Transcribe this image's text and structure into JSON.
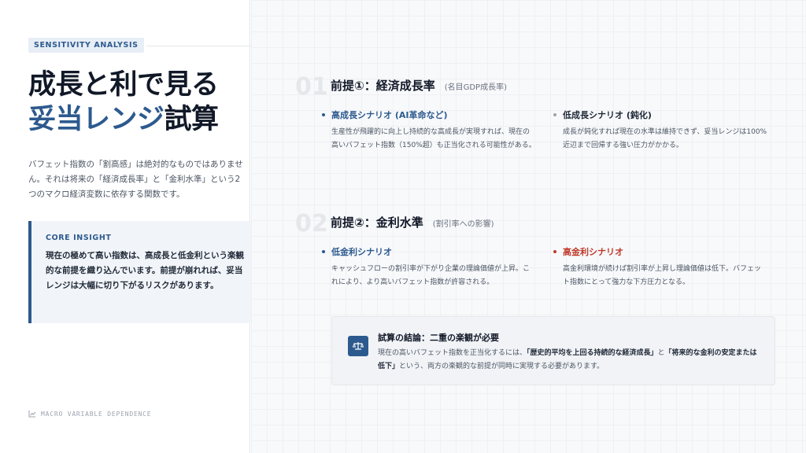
{
  "left": {
    "tag": "SENSITIVITY ANALYSIS",
    "title_line1": "成長と利で見る",
    "title_accent": "妥当レンジ",
    "title_rest": "試算",
    "intro": "バフェット指数の「割高感」は絶対的なものではありません。それは将来の「経済成長率」と「金利水準」という2つのマクロ経済変数に依存する関数です。",
    "insight_title": "CORE INSIGHT",
    "insight_body": "現在の極めて高い指数は、高成長と低金利という楽観的な前提を織り込んでいます。前提が崩れれば、妥当レンジは大幅に切り下がるリスクがあります。",
    "footer": "MACRO VARIABLE DEPENDENCE"
  },
  "sections": [
    {
      "num": "01",
      "title": "前提①：経済成長率",
      "sub": "(名目GDP成長率)",
      "cols": [
        {
          "title": "高成長シナリオ (AI革命など)",
          "body": "生産性が飛躍的に向上し持続的な高成長が実現すれば、現在の高いバフェット指数（150%超）も正当化される可能性がある。"
        },
        {
          "title": "低成長シナリオ (鈍化)",
          "body": "成長が鈍化すれば現在の水準は維持できず、妥当レンジは100%近辺まで回帰する強い圧力がかかる。"
        }
      ]
    },
    {
      "num": "02",
      "title": "前提②：金利水準",
      "sub": "(割引率への影響)",
      "cols": [
        {
          "title": "低金利シナリオ",
          "body": "キャッシュフローの割引率が下がり企業の理論価値が上昇。これにより、より高いバフェット指数が許容される。"
        },
        {
          "title": "高金利シナリオ",
          "body": "高金利環境が続けば割引率が上昇し理論価値は低下。バフェット指数にとって強力な下方圧力となる。"
        }
      ]
    }
  ],
  "conclusion": {
    "title": "試算の結論：二重の楽観が必要",
    "body_pre": "現在の高いバフェット指数を正当化するには、",
    "body_bold1": "「歴史的平均を上回る持続的な経済成長」",
    "body_mid": "と",
    "body_bold2": "「将来的な金利の安定または低下」",
    "body_post": "という、両方の楽観的な前提が同時に実現する必要があります。"
  },
  "colors": {
    "accent": "#2d5a8e",
    "danger": "#c0392b"
  }
}
